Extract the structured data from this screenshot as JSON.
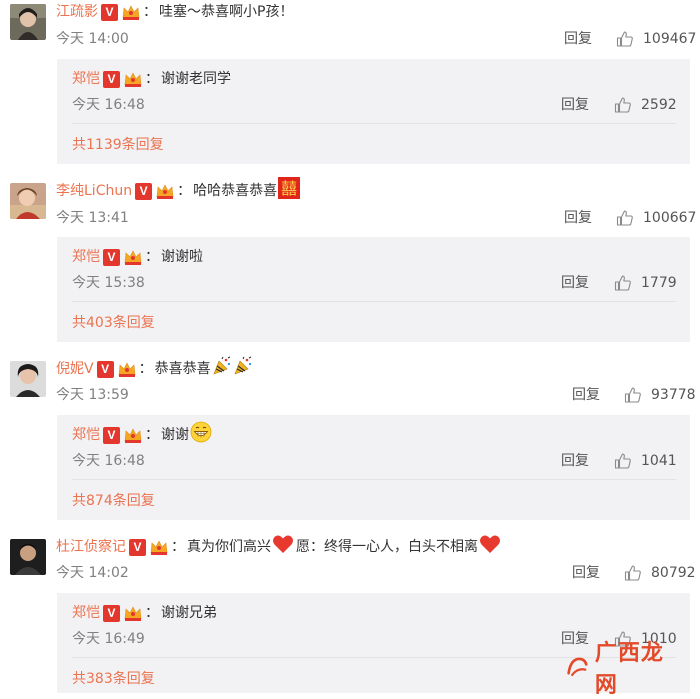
{
  "comments": [
    {
      "user": "江疏影",
      "colon": "：",
      "text": "哇塞～恭喜啊小P孩！",
      "text_after": "",
      "time": "今天 14:00",
      "reply_label": "回复",
      "likes": "109467",
      "reply": {
        "user": "郑恺",
        "colon": "：",
        "text": "谢谢老同学",
        "time": "今天 16:48",
        "reply_label": "回复",
        "likes": "2592"
      },
      "more": "共1139条回复"
    },
    {
      "user": "李纯LiChun",
      "colon": "：",
      "text": "哈哈恭喜恭喜",
      "text_after": "",
      "time": "今天 13:41",
      "reply_label": "回复",
      "likes": "100667",
      "reply": {
        "user": "郑恺",
        "colon": "：",
        "text": "谢谢啦",
        "time": "今天 15:38",
        "reply_label": "回复",
        "likes": "1779"
      },
      "more": "共403条回复"
    },
    {
      "user": "倪妮V",
      "colon": "：",
      "text": "恭喜恭喜",
      "text_after": "",
      "time": "今天 13:59",
      "reply_label": "回复",
      "likes": "93778",
      "reply": {
        "user": "郑恺",
        "colon": "：",
        "text": "谢谢",
        "time": "今天 16:48",
        "reply_label": "回复",
        "likes": "1041"
      },
      "more": "共874条回复"
    },
    {
      "user": "杜江侦察记",
      "colon": "：",
      "text": "真为你们高兴",
      "text_after": "愿：终得一心人，白头不相离",
      "time": "今天 14:02",
      "reply_label": "回复",
      "likes": "80792",
      "reply": {
        "user": "郑恺",
        "colon": "：",
        "text": "谢谢兄弟",
        "time": "今天 16:49",
        "reply_label": "回复",
        "likes": "1010"
      },
      "more": "共383条回复"
    }
  ],
  "badges": {
    "verified": "V"
  },
  "emoji": {
    "double_happiness": "囍"
  },
  "watermark": {
    "text": "广西龙网"
  },
  "colors": {
    "username": "#eb7350",
    "reply_bg": "#f2f2f5",
    "verified": "#e3372d",
    "heart": "#e8392e"
  }
}
